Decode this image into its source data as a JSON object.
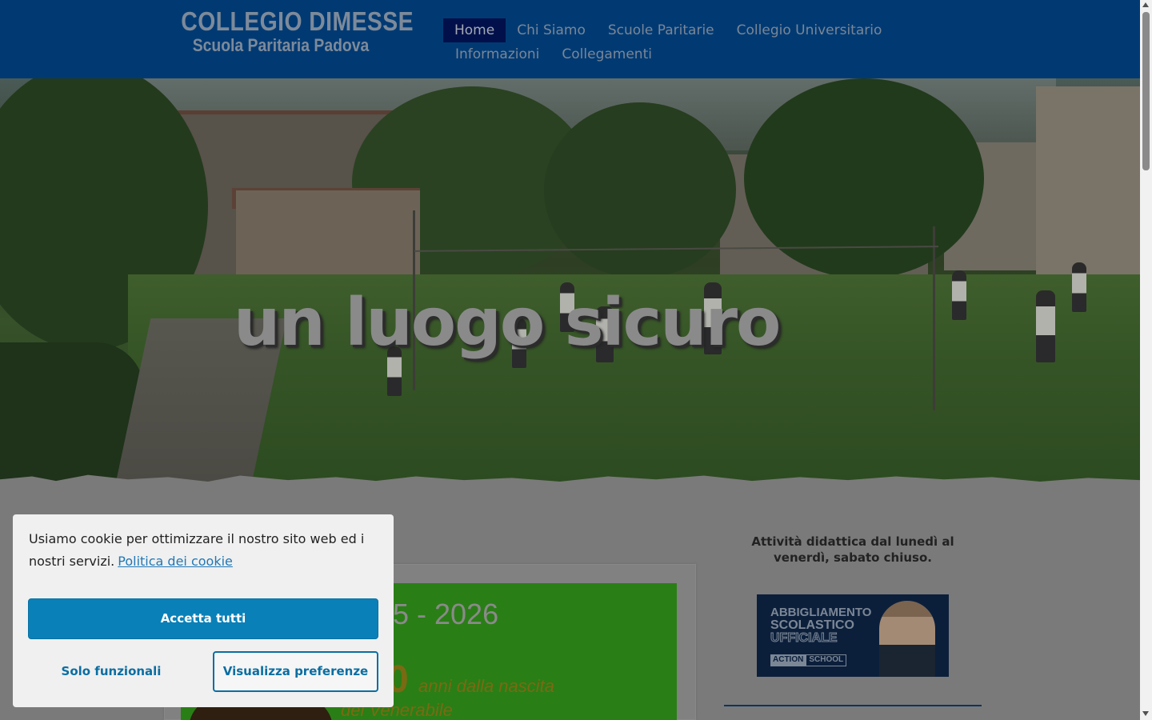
{
  "header": {
    "logo_title": "COLLEGIO DIMESSE",
    "logo_subtitle": "Scuola Paritaria Padova",
    "nav": [
      {
        "label": "Home",
        "active": true
      },
      {
        "label": "Chi Siamo"
      },
      {
        "label": "Scuole Paritarie"
      },
      {
        "label": "Collegio Universitario"
      },
      {
        "label": "Informazioni"
      },
      {
        "label": "Collegamenti"
      }
    ]
  },
  "hero": {
    "title": "un luogo sicuro"
  },
  "main": {
    "poster": {
      "year_text": "5 - 2026",
      "number_text": "0",
      "line1": "anni dalla nascita",
      "line2": "del Venerabile"
    }
  },
  "sidebar": {
    "schedule_text": "Attività didattica dal lunedì al venerdì, sabato chiuso.",
    "ad": {
      "line1": "ABBIGLIAMENTO",
      "line2": "SCOLASTICO",
      "line3": "UFFICIALE",
      "badge_a": "ACTION",
      "badge_b": "SCHOOL"
    }
  },
  "cookie_banner": {
    "message": "Usiamo cookie per ottimizzare il nostro sito web ed i nostri servizi.",
    "policy_link": "Politica dei cookie",
    "accept_all": "Accetta tutti",
    "functional_only": "Solo funzionali",
    "view_preferences": "Visualizza preferenze"
  },
  "colors": {
    "header_bg": "#013a73",
    "accent_button": "#0a80b8",
    "nav_active_bg": "#01104a"
  }
}
